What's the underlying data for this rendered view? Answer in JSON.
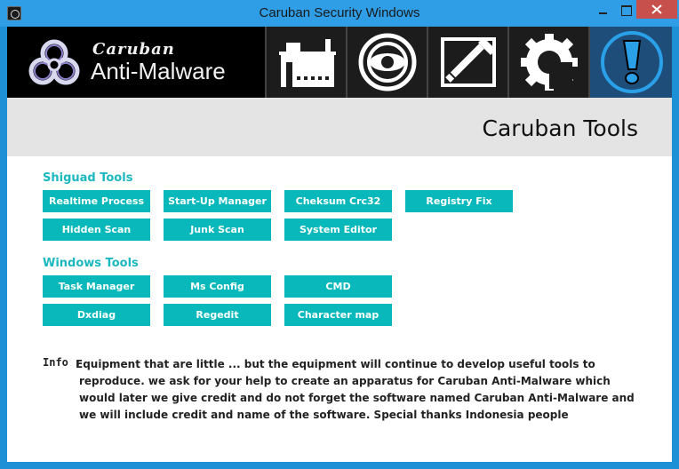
{
  "window": {
    "title": "Caruban Security Windows"
  },
  "logo": {
    "line1": "Caruban",
    "line2": "Anti-Malware"
  },
  "nav": {
    "tabs": [
      {
        "icon": "building-icon"
      },
      {
        "icon": "eye-target-icon"
      },
      {
        "icon": "tools-icon"
      },
      {
        "icon": "gear-icon"
      },
      {
        "icon": "exclamation-icon",
        "active": true
      }
    ]
  },
  "banner": {
    "title": "Caruban Tools"
  },
  "sections": {
    "shiguad": {
      "title": "Shiguad Tools",
      "buttons": [
        "Realtime Process",
        "Start-Up Manager",
        "Cheksum Crc32",
        "Registry Fix",
        "Hidden Scan",
        "Junk Scan",
        "System Editor"
      ]
    },
    "windows": {
      "title": "Windows Tools",
      "buttons": [
        "Task Manager",
        "Ms Config",
        "CMD",
        "Dxdiag",
        "Regedit",
        "Character map"
      ]
    }
  },
  "info": {
    "label": "Info :",
    "text": "Equipment that are little ... but the equipment will continue to develop useful tools to reproduce. we ask for your help to create an apparatus for Caruban Anti-Malware which would later we give credit and do not forget the software named Caruban Anti-Malware and we will include credit and name of the software. Special thanks Indonesia people"
  },
  "colors": {
    "accent": "#08b8ba",
    "section_title": "#1cb8c0",
    "titlebar": "#2f9ee6",
    "close": "#c7504c",
    "active_tab": "#1d4d78"
  }
}
